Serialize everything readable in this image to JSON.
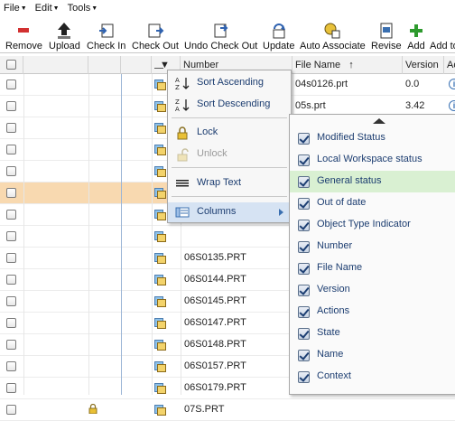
{
  "menubar": [
    {
      "label": "File"
    },
    {
      "label": "Edit"
    },
    {
      "label": "Tools"
    }
  ],
  "toolbar": {
    "buttons": [
      {
        "label": "Remove",
        "icon": "remove-icon"
      },
      {
        "label": "Upload",
        "icon": "upload-icon"
      },
      {
        "label": "Check In",
        "icon": "check-in-icon"
      },
      {
        "label": "Check Out",
        "icon": "check-out-icon"
      },
      {
        "label": "Undo Check Out",
        "icon": "undo-check-out-icon"
      },
      {
        "label": "Update",
        "icon": "update-icon"
      },
      {
        "label": "Auto Associate",
        "icon": "auto-associate-icon"
      },
      {
        "label": "Revise",
        "icon": "revise-icon"
      },
      {
        "label": "Add",
        "icon": "add-icon"
      },
      {
        "label": "Add to"
      }
    ]
  },
  "table": {
    "headers": {
      "number": "Number",
      "file_name": "File Name",
      "sort_indicator": "↑",
      "version": "Version",
      "actions": "Ac"
    },
    "rows": [
      {
        "number": "",
        "file_name": "04s0126.prt",
        "version": "0.0",
        "selected": false
      },
      {
        "number": "",
        "file_name": "05s.prt",
        "version": "3.42",
        "selected": false
      },
      {
        "number": "",
        "file_name": "",
        "version": "",
        "selected": false
      },
      {
        "number": "",
        "file_name": "",
        "version": "",
        "selected": false
      },
      {
        "number": "",
        "file_name": "",
        "version": "",
        "selected": false
      },
      {
        "number": "",
        "file_name": "",
        "version": "",
        "selected": true
      },
      {
        "number": "",
        "file_name": "",
        "version": "",
        "selected": false
      },
      {
        "number": "",
        "file_name": "",
        "version": "",
        "selected": false
      },
      {
        "number": "06S0135.PRT",
        "file_name": "",
        "version": "",
        "selected": false
      },
      {
        "number": "06S0144.PRT",
        "file_name": "",
        "version": "",
        "selected": false
      },
      {
        "number": "06S0145.PRT",
        "file_name": "",
        "version": "",
        "selected": false
      },
      {
        "number": "06S0147.PRT",
        "file_name": "",
        "version": "",
        "selected": false
      },
      {
        "number": "06S0148.PRT",
        "file_name": "",
        "version": "",
        "selected": false
      },
      {
        "number": "06S0157.PRT",
        "file_name": "",
        "version": "",
        "selected": false
      },
      {
        "number": "06S0179.PRT",
        "file_name": "",
        "version": "",
        "selected": false
      },
      {
        "number": "07S.PRT",
        "file_name": "",
        "version": "",
        "selected": false
      }
    ]
  },
  "context_menu": {
    "items": [
      {
        "label": "Sort Ascending",
        "icon": "sort-ascending-icon",
        "disabled": false
      },
      {
        "label": "Sort Descending",
        "icon": "sort-descending-icon",
        "disabled": false
      },
      {
        "label": "Lock",
        "icon": "lock-icon",
        "disabled": false
      },
      {
        "label": "Unlock",
        "icon": "unlock-icon",
        "disabled": true
      },
      {
        "label": "Wrap Text",
        "icon": "wrap-text-icon",
        "disabled": false
      },
      {
        "label": "Columns",
        "icon": "columns-icon",
        "disabled": false
      }
    ]
  },
  "columns_menu": {
    "items": [
      {
        "label": "Modified Status",
        "checked": true
      },
      {
        "label": "Local Workspace status",
        "checked": true
      },
      {
        "label": "General status",
        "checked": true,
        "highlighted": true
      },
      {
        "label": "Out of date",
        "checked": true
      },
      {
        "label": "Object Type Indicator",
        "checked": true
      },
      {
        "label": "Number",
        "checked": true
      },
      {
        "label": "File Name",
        "checked": true
      },
      {
        "label": "Version",
        "checked": true
      },
      {
        "label": "Actions",
        "checked": true
      },
      {
        "label": "State",
        "checked": true
      },
      {
        "label": "Name",
        "checked": true
      },
      {
        "label": "Context",
        "checked": true
      }
    ]
  },
  "colors": {
    "selected_row": "#f8d9b0",
    "menu_text": "#1c3d70",
    "highlight": "#d9f0d2",
    "add_green": "#2e9a2e",
    "remove_red": "#d23030"
  }
}
